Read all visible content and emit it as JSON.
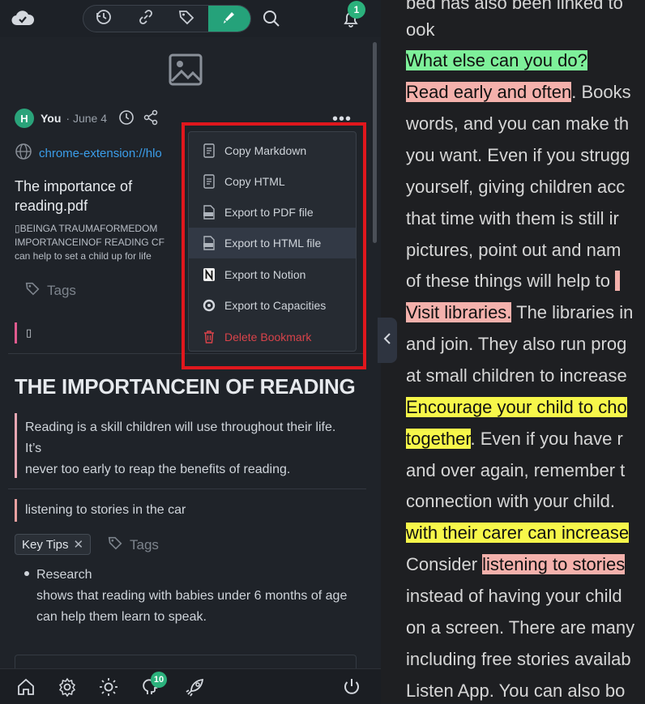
{
  "topbar": {
    "notification_count": "1"
  },
  "item": {
    "avatar_letter": "H",
    "author": "You",
    "date": "· June 4",
    "url": "chrome-extension://hlo",
    "title": "The importance of reading.pdf",
    "snippet_line1": "▯BEINGA TRAUMAFORMEDOM",
    "snippet_line2": "IMPORTANCEINOF READING CF",
    "snippet_line3": "can help to set a child up for life",
    "tags_placeholder": "Tags",
    "highlight1": "▯"
  },
  "content": {
    "heading": "THE IMPORTANCEIN OF READING",
    "quote_line1": "Reading is a skill children will use throughout their life. It’s",
    "quote_line2": "never too early to reap the benefits of reading.",
    "highlight2": "listening to stories in the car",
    "tag_key_tips": "Key Tips",
    "tags_placeholder": "Tags",
    "bullet_line1": "Research",
    "bullet_line2": "shows that reading with babies under 6 months of age",
    "bullet_line3": "can help them learn to speak."
  },
  "menu": {
    "items": [
      {
        "label": "Copy Markdown",
        "icon": "document-icon"
      },
      {
        "label": "Copy HTML",
        "icon": "document-icon"
      },
      {
        "label": "Export to PDF file",
        "icon": "pdf-file-icon"
      },
      {
        "label": "Export to HTML file",
        "icon": "html-file-icon"
      },
      {
        "label": "Export to Notion",
        "icon": "notion-icon"
      },
      {
        "label": "Export to Capacities",
        "icon": "capacities-icon"
      },
      {
        "label": "Delete Bookmark",
        "icon": "trash-icon"
      }
    ]
  },
  "bottombar": {
    "brain_badge": "10"
  },
  "reader": {
    "line1": "bed has also been linked to",
    "line2": "ook",
    "line3": "What else can you do?",
    "line4a": "Read early and often",
    "line4b": ". Books",
    "line5": "words, and you can make th",
    "line6": "you want. Even if you strugg",
    "line7": "yourself, giving children acc",
    "line8": "that time with them is still ir",
    "line9": "pictures, point out and nam",
    "line10": "of these things will help to",
    "line11a": "Visit libraries.",
    "line11b": " The libraries in",
    "line12": "and join. They also run prog",
    "line13": "at small children to increase",
    "line14": "Encourage your child to cho",
    "line15a": "together",
    "line15b": ". Even if you have r",
    "line16": "and over again, remember t",
    "line17": "connection with your child.",
    "line18": "with their carer can increase",
    "line19a": "Consider ",
    "line19b": "listening to stories",
    "line20": "instead of having your child",
    "line21": "on a screen. There are many",
    "line22": "including free stories availab",
    "line23": "Listen App. You can also bo"
  },
  "colors": {
    "accent_green": "#25a27a",
    "link_blue": "#3b9eea",
    "highlight_green": "#7ef09a",
    "highlight_pink": "#f4b1ac",
    "highlight_yellow": "#f7f74a",
    "danger_red": "#d8434a",
    "annotation_red": "#e0171d"
  }
}
